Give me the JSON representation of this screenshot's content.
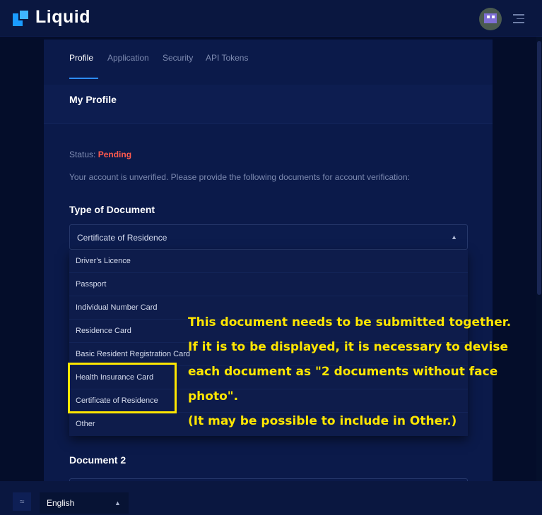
{
  "app": {
    "logo_text": "Liquid",
    "brand_color": "#1a9bff"
  },
  "tabs": [
    {
      "label": "Profile",
      "active": true
    },
    {
      "label": "Application",
      "active": false
    },
    {
      "label": "Security",
      "active": false
    },
    {
      "label": "API Tokens",
      "active": false
    }
  ],
  "page_title": "My Profile",
  "status": {
    "label": "Status: ",
    "value": "Pending",
    "color": "#ff5a4e"
  },
  "description": "Your account is unverified. Please provide the following documents for account verification:",
  "type_of_document": {
    "title": "Type of Document",
    "selected": "Certificate of Residence",
    "options": [
      "Driver's Licence",
      "Passport",
      "Individual Number Card",
      "Residence Card",
      "Basic Resident Registration Card",
      "Health Insurance Card",
      "Certificate of Residence",
      "Other"
    ]
  },
  "document2": {
    "title": "Document 2"
  },
  "annotation": {
    "color": "#ffe600",
    "lines": [
      "This document needs to be submitted together.",
      "If it is to be displayed, it is necessary to devise",
      "each document as \"2 documents without face",
      "photo\".",
      "(It may be possible to include in Other.)"
    ]
  },
  "footer": {
    "language": "English"
  },
  "icons": {
    "top_right": [
      "avatar",
      "menu-icon"
    ],
    "footer": [
      "waves-icon",
      "chevron-up-icon"
    ]
  }
}
